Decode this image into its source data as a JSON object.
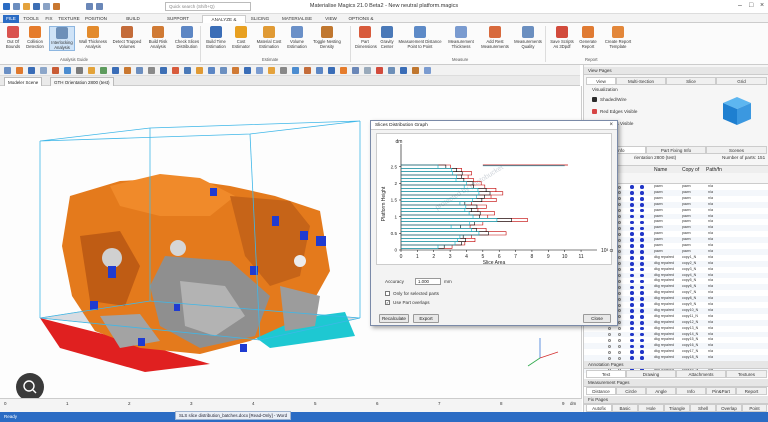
{
  "window": {
    "title": "Materialise Magics 21.0 Beta2 - New neutral platform.magics",
    "search_placeholder": "Quick search (Shift+Q)"
  },
  "ribbon_tabs": [
    "FILE",
    "TOOLS",
    "FIX",
    "TEXTURE",
    "POSITION",
    "BUILD PREPARATION",
    "SUPPORT GENERATION",
    "ANALYZE & REPORT",
    "SLICING",
    "MATERIALISE SOFTWARE",
    "VIEW",
    "OPTIONS & HELP"
  ],
  "ribbon_active_tab": "ANALYZE & REPORT",
  "ribbon_buttons": [
    {
      "label": "Out Of Bounds",
      "icon": "out-of-bounds-icon",
      "color": "#d9534f"
    },
    {
      "label": "Collision Detection",
      "icon": "collision-icon",
      "color": "#e57c2c"
    },
    {
      "label": "Interlocking Analysis",
      "icon": "interlocking-icon",
      "color": "#6d8fb8"
    },
    {
      "label": "Wall Thickness Analysis",
      "icon": "wall-thickness-icon",
      "color": "#e38b2d"
    },
    {
      "label": "Detect Trapped Volumes",
      "icon": "trapped-volumes-icon",
      "color": "#c46c3a"
    },
    {
      "label": "Build Risk Analysis",
      "icon": "build-risk-icon",
      "color": "#d07a34"
    },
    {
      "label": "Check Slices Distribution",
      "icon": "slices-icon",
      "color": "#5c86c4"
    },
    {
      "label": "Build Time Estimation",
      "icon": "clock-icon",
      "color": "#3a6db7"
    },
    {
      "label": "Cost Estimator",
      "icon": "euro-icon",
      "color": "#e8a020"
    },
    {
      "label": "Material Cost Estimation",
      "icon": "material-cost-icon",
      "color": "#e09a34"
    },
    {
      "label": "Volume Estimation",
      "icon": "volume-icon",
      "color": "#6a90c8"
    },
    {
      "label": "Toggle Nesting Density",
      "icon": "nesting-icon",
      "color": "#c0772f"
    },
    {
      "label": "Part Dimensions",
      "icon": "dimensions-icon",
      "color": "#d85b3c"
    },
    {
      "label": "Gravity Center",
      "icon": "gravity-icon",
      "color": "#4a79b8"
    },
    {
      "label": "Measurement Distance Point to Point",
      "icon": "ruler-icon",
      "color": "#5d8ac7"
    },
    {
      "label": "Measurement Thickness",
      "icon": "thickness-icon",
      "color": "#7a9bd0"
    },
    {
      "label": "Add Rest Measurements",
      "icon": "add-measure-icon",
      "color": "#d86a3d"
    },
    {
      "label": "Measurements Quality",
      "icon": "quality-icon",
      "color": "#6b8fc0"
    },
    {
      "label": "Save Scripts As 3Dpdf",
      "icon": "pdf-icon",
      "color": "#d24b3c"
    },
    {
      "label": "Generate Report",
      "icon": "report-icon",
      "color": "#e07b33"
    },
    {
      "label": "Create Report Template",
      "icon": "template-icon",
      "color": "#e3873a"
    }
  ],
  "ribbon_groups": [
    "Analysis Guide",
    "Estimate",
    "Measure",
    "Report"
  ],
  "doc_tabs": [
    "Modeler Scene",
    "GTH Orientation 2800 (test)"
  ],
  "ruler": {
    "labels": [
      "0",
      "1",
      "2",
      "3",
      "4",
      "5",
      "6",
      "7",
      "8",
      "9"
    ],
    "unit": "dm"
  },
  "status_text": "Ready",
  "taskbar_chip": "SLS slice distribution_batches.docx [Read-Only] - Word",
  "right_panel": {
    "view_pages_title": "View Pages",
    "view_tabs": [
      "View",
      "Multi-Section",
      "Slice",
      "Grid"
    ],
    "visualization_label": "Visualization",
    "vis_items": [
      "Shaded/Wire",
      "Red Edges Visible",
      "Triangles Visible"
    ],
    "part_tabs": [
      "Part Info",
      "Part Fixing Info",
      "Scenes"
    ],
    "platform_label": "rientation 2800 (test)",
    "num_parts": "Number of parts: 151",
    "columns": [
      "Name",
      "Copy of",
      "Path/fn"
    ],
    "rows": [
      {
        "name": "pawn",
        "copy": "pawn",
        "path": "n/a"
      },
      {
        "name": "pawn",
        "copy": "pawn",
        "path": "n/a"
      },
      {
        "name": "pawn",
        "copy": "pawn",
        "path": "n/a"
      },
      {
        "name": "pawn",
        "copy": "pawn",
        "path": "n/a"
      },
      {
        "name": "pawn",
        "copy": "pawn",
        "path": "n/a"
      },
      {
        "name": "pawn",
        "copy": "pawn",
        "path": "n/a"
      },
      {
        "name": "pawn",
        "copy": "pawn",
        "path": "n/a"
      },
      {
        "name": "pawn",
        "copy": "pawn",
        "path": "n/a"
      },
      {
        "name": "pawn",
        "copy": "pawn",
        "path": "n/a"
      },
      {
        "name": "pawn",
        "copy": "pawn",
        "path": "n/a"
      },
      {
        "name": "pawn",
        "copy": "pawn",
        "path": "n/a"
      },
      {
        "name": "pawn",
        "copy": "pawn",
        "path": "n/a"
      },
      {
        "name": "dkg repaired",
        "copy": "copy1_N",
        "path": "n/a"
      },
      {
        "name": "dkg repaired",
        "copy": "copy2_N",
        "path": "n/a"
      },
      {
        "name": "dkg repaired",
        "copy": "copy3_N",
        "path": "n/a"
      },
      {
        "name": "dkg repaired",
        "copy": "copy4_N",
        "path": "n/a"
      },
      {
        "name": "dkg repaired",
        "copy": "copy5_N",
        "path": "n/a"
      },
      {
        "name": "dkg repaired",
        "copy": "copy6_N",
        "path": "n/a"
      },
      {
        "name": "dkg repaired",
        "copy": "copy7_N",
        "path": "n/a"
      },
      {
        "name": "dkg repaired",
        "copy": "copy8_N",
        "path": "n/a"
      },
      {
        "name": "dkg repaired",
        "copy": "copy9_N",
        "path": "n/a"
      },
      {
        "name": "dkg repaired",
        "copy": "copy10_N",
        "path": "n/a"
      },
      {
        "name": "dkg repaired",
        "copy": "copy11_N",
        "path": "n/a"
      },
      {
        "name": "dkg repaired",
        "copy": "copy12_N",
        "path": "n/a"
      },
      {
        "name": "dkg repaired",
        "copy": "copy13_N",
        "path": "n/a"
      },
      {
        "name": "dkg repaired",
        "copy": "copy14_N",
        "path": "n/a"
      },
      {
        "name": "dkg repaired",
        "copy": "copy15_N",
        "path": "n/a"
      },
      {
        "name": "dkg repaired",
        "copy": "copy16_N",
        "path": "n/a"
      },
      {
        "name": "dkg repaired",
        "copy": "copy17_N",
        "path": "n/a"
      },
      {
        "name": "dkg repaired",
        "copy": "copy18_N",
        "path": "n/a"
      },
      {
        "name": "dkg repaired",
        "copy": "copy19_N",
        "path": "n/a"
      },
      {
        "name": "dkg repaired",
        "copy": "copy20_N",
        "path": "n/a"
      },
      {
        "name": "dkg repaired",
        "copy": "copy21_N",
        "path": "n/a"
      },
      {
        "name": "dkg repaired",
        "copy": "copy22_N",
        "path": "n/a"
      },
      {
        "name": "dkg repaired",
        "copy": "copy23_N",
        "path": "n/a"
      }
    ],
    "annotation_title": "Annotation Pages",
    "annotation_tabs": [
      "Text",
      "Drawing",
      "Attachments",
      "Textures"
    ],
    "measurement_title": "Measurement Pages",
    "measurement_tabs": [
      "Distance",
      "Circle",
      "Angle",
      "Info",
      "Pin&Part",
      "Report"
    ],
    "fix_title": "Fix Pages",
    "fix_tabs": [
      "Autofix",
      "Basic",
      "Hole",
      "Triangle",
      "Shell",
      "Overlap",
      "Point"
    ]
  },
  "dialog": {
    "title": "Slices Distribution Graph",
    "accuracy_label": "Accuracy",
    "accuracy_value": "1.000",
    "accuracy_unit": "mm",
    "only_selected_label": "Only for selected parts",
    "use_overlap_label": "Use Part overlaps",
    "only_selected_checked": false,
    "use_overlap_checked": true,
    "recalculate_label": "Recalculate",
    "export_label": "Export",
    "close_label": "Close",
    "watermark": "protected by photobucket"
  },
  "chart_data": {
    "type": "line",
    "title": "",
    "xlabel": "Slice Area",
    "ylabel": "Platform Height",
    "x_unit_label": "10³ cm²",
    "y_unit_label": "dm",
    "xlim": [
      0,
      10
    ],
    "ylim": [
      0,
      3
    ],
    "x_ticks": [
      0,
      1,
      2,
      3,
      4,
      5,
      6,
      7,
      8,
      9,
      10,
      11
    ],
    "y_ticks": [
      0,
      0.5,
      1,
      1.5,
      2,
      2.5
    ],
    "y_positions": [
      0.05,
      0.15,
      0.25,
      0.35,
      0.45,
      0.55,
      0.65,
      0.75,
      0.85,
      0.95,
      1.05,
      1.15,
      1.25,
      1.35,
      1.45,
      1.55,
      1.65,
      1.75,
      1.85,
      1.95,
      2.05,
      2.15,
      2.25,
      2.35,
      2.45
    ],
    "series": [
      {
        "color": "#c00000",
        "values": [
          3.2,
          3.8,
          4.6,
          4.2,
          6.5,
          5.1,
          4.3,
          4.9,
          7.8,
          5.2,
          5.8,
          4.6,
          5.3,
          4.2,
          5.9,
          5.4,
          6.3,
          5.7,
          5.2,
          4.8,
          4.5,
          4.0,
          4.4,
          3.6,
          3.1
        ]
      },
      {
        "color": "#000000",
        "values": [
          2.8,
          3.5,
          4.1,
          3.6,
          5.5,
          4.4,
          3.8,
          4.3,
          6.9,
          4.6,
          5.0,
          4.1,
          4.8,
          3.7,
          5.1,
          4.9,
          5.6,
          5.0,
          4.6,
          4.2,
          4.0,
          3.5,
          3.9,
          3.2,
          2.9
        ]
      },
      {
        "color": "#00b0c8",
        "values": [
          2.5,
          3.0,
          3.7,
          3.3,
          5.0,
          4.0,
          3.3,
          3.9,
          6.1,
          4.1,
          4.4,
          3.6,
          4.2,
          3.3,
          4.6,
          4.3,
          5.0,
          4.4,
          4.1,
          3.7,
          3.6,
          3.1,
          3.4,
          2.8,
          2.5
        ]
      }
    ],
    "peak": {
      "y": 2.55,
      "x": 10.2
    },
    "grid": false
  }
}
